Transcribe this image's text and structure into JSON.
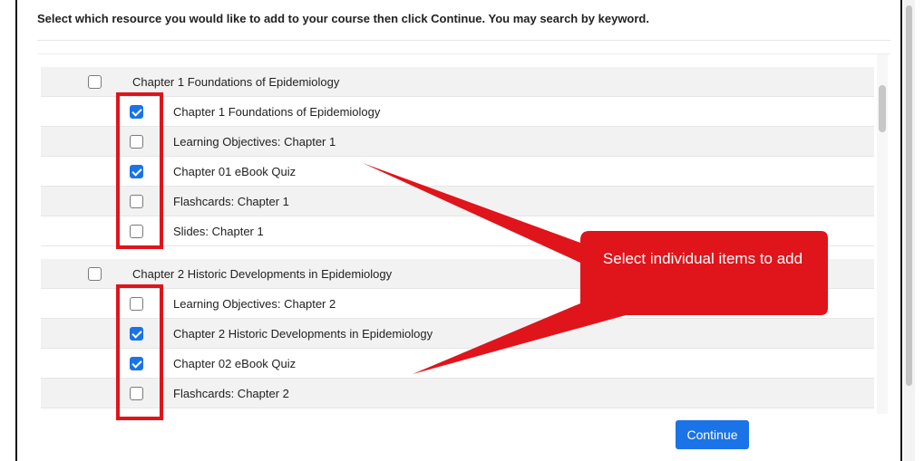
{
  "instructions": {
    "prefix": "Select which resource you would like to add to your course then click ",
    "emphasis": "Continue",
    "suffix": ". You may search by keyword."
  },
  "groups": [
    {
      "label": "Chapter 1 Foundations of Epidemiology",
      "checked": false,
      "items": [
        {
          "label": "Chapter 1 Foundations of Epidemiology",
          "checked": true
        },
        {
          "label": "Learning Objectives: Chapter 1",
          "checked": false
        },
        {
          "label": "Chapter 01 eBook Quiz",
          "checked": true
        },
        {
          "label": "Flashcards: Chapter 1",
          "checked": false
        },
        {
          "label": "Slides: Chapter 1",
          "checked": false
        }
      ]
    },
    {
      "label": "Chapter 2 Historic Developments in Epidemiology",
      "checked": false,
      "items": [
        {
          "label": "Learning Objectives: Chapter 2",
          "checked": false
        },
        {
          "label": "Chapter 2 Historic Developments in Epidemiology",
          "checked": true
        },
        {
          "label": "Chapter 02 eBook Quiz",
          "checked": true
        },
        {
          "label": "Flashcards: Chapter 2",
          "checked": false
        }
      ]
    }
  ],
  "callout": {
    "text": "Select individual items to add",
    "color": "#e0141b"
  },
  "continue_label": "Continue",
  "colors": {
    "accent": "#1b73e8",
    "highlight": "#e0141b"
  }
}
